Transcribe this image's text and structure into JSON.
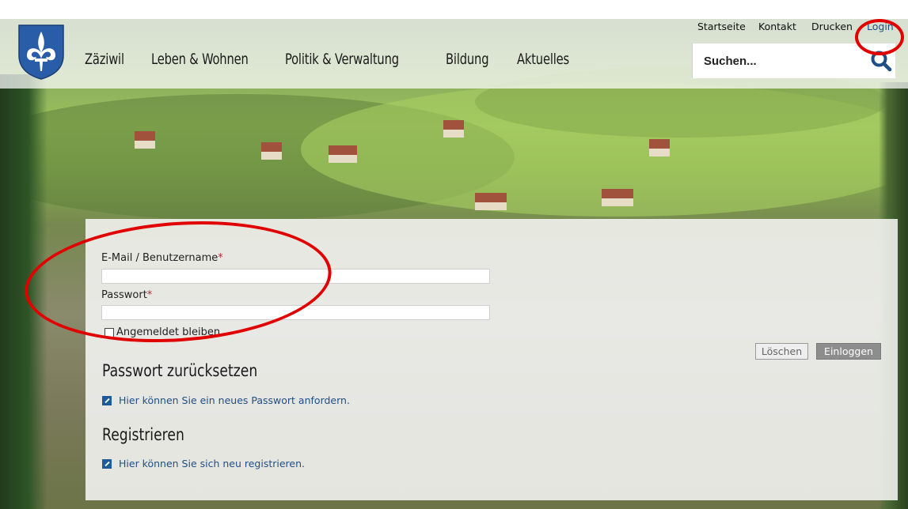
{
  "header": {
    "nav": [
      "Zäziwil",
      "Leben & Wohnen",
      "Politik & Verwaltung",
      "Bildung",
      "Aktuelles"
    ],
    "top_links": {
      "home": "Startseite",
      "contact": "Kontakt",
      "print": "Drucken",
      "login": "Login"
    },
    "search": {
      "placeholder": "Suchen...",
      "icon": "search-icon"
    }
  },
  "login_form": {
    "email_label": "E-Mail / Benutzername",
    "password_label": "Passwort",
    "required_mark": "*",
    "remember_label": "Angemeldet bleiben",
    "clear_button": "Löschen",
    "login_button": "Einloggen"
  },
  "reset": {
    "heading": "Passwort zurücksetzen",
    "link": "Hier können Sie ein neues Passwort anfordern."
  },
  "register": {
    "heading": "Registrieren",
    "link": "Hier können Sie sich neu registrieren."
  },
  "colors": {
    "link": "#1f4f86",
    "annotation": "#e10000",
    "crest_blue": "#2a5da8"
  }
}
